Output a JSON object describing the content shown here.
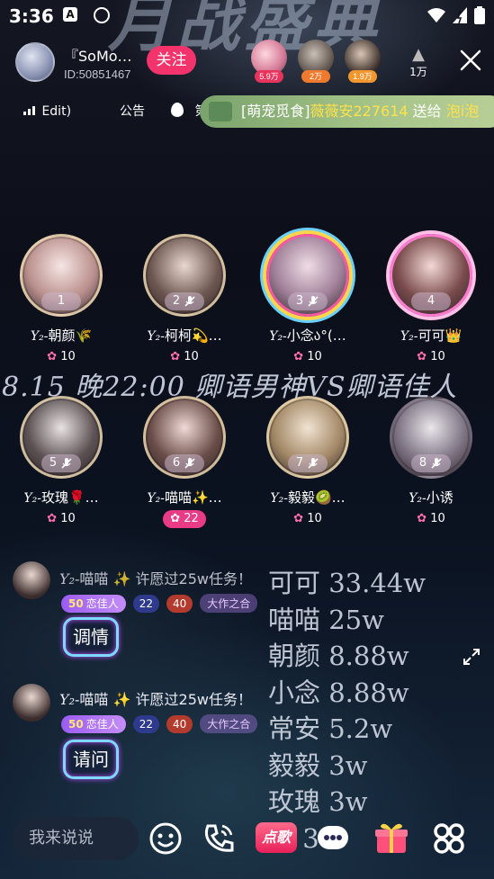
{
  "status_bar": {
    "time": "3:36",
    "icon_a": "A"
  },
  "header": {
    "host_name": "『SoMo…",
    "host_id": "ID:50851467",
    "follow_label": "关注",
    "top_viewers": [
      {
        "count": "5.9万",
        "color": "#e8335d"
      },
      {
        "count": "2万",
        "color": "#ef7a2e"
      },
      {
        "count": "1.9万",
        "color": "#f2962e"
      }
    ],
    "popularity": "1万",
    "icons": [
      "fire-icon",
      "close-icon"
    ]
  },
  "tabs_bar": {
    "room_tag": "Edit)",
    "notice_label": "公告",
    "rank_label": "第"
  },
  "gift_marquee": {
    "room": "[萌宠觅食]",
    "sender": "薇薇安227614",
    "verb": " 送给 ",
    "receiver": "泡i泡"
  },
  "seats": [
    {
      "no": "1",
      "name": "朝颜",
      "emoji": "🌾",
      "hot": "10",
      "mute": false,
      "frame": "gold"
    },
    {
      "no": "2",
      "name": "柯柯💫…",
      "emoji": "",
      "hot": "10",
      "mute": true,
      "frame": "gold"
    },
    {
      "no": "3",
      "name": "小念ა°(…",
      "emoji": "",
      "hot": "10",
      "mute": true,
      "frame": "rain"
    },
    {
      "no": "4",
      "name": "可可",
      "emoji": "👑",
      "hot": "10",
      "mute": false,
      "frame": "pink"
    },
    {
      "no": "5",
      "name": "玫瑰🌹…",
      "emoji": "",
      "hot": "10",
      "mute": true,
      "frame": "gold"
    },
    {
      "no": "6",
      "name": "喵喵✨…",
      "emoji": "",
      "hot": "22",
      "mute": true,
      "frame": "gold"
    },
    {
      "no": "7",
      "name": "毅毅🥝…",
      "emoji": "",
      "hot": "10",
      "mute": true,
      "frame": "gold"
    },
    {
      "no": "8",
      "name": "小诱",
      "emoji": "",
      "hot": "10",
      "mute": true,
      "frame": "none"
    }
  ],
  "name_prefix": "Y₂-",
  "announcement": "8.15 晚22:00 卿语男神VS卿语佳人",
  "chat": [
    {
      "name": "喵喵",
      "text": "✨ 许愿过25w任务！",
      "level": "50",
      "level_tag": "恋佳人",
      "shield": "22",
      "fire": "40",
      "wing": "大作之合",
      "bubble": "调情"
    },
    {
      "name": "喵喵",
      "text": "✨ 许愿过25w任务！",
      "level": "50",
      "level_tag": "恋佳人",
      "shield": "22",
      "fire": "40",
      "wing": "大作之合",
      "bubble": "请问"
    }
  ],
  "rank_overlay": [
    "可可 33.44w",
    "喵喵 25w",
    "朝颜 8.88w",
    "小念 8.88w",
    "常安 5.2w",
    "毅毅 3w",
    "玫瑰 3w",
    "柒 3w"
  ],
  "bottom_bar": {
    "input_placeholder": "我来说说",
    "song_label": "点歌",
    "icons": [
      "emoji-icon",
      "phone-icon",
      "song-icon",
      "chat-icon",
      "gift-icon",
      "more-icon"
    ]
  },
  "colors": {
    "accent": "#f2336c",
    "marquee": "#9bbd7f",
    "highlight": "#ffe14a"
  }
}
